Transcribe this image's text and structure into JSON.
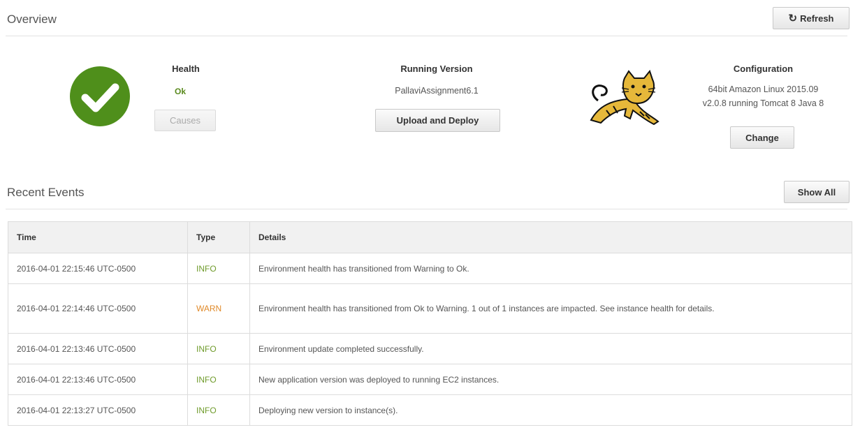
{
  "overview": {
    "title": "Overview",
    "refresh_label": "Refresh"
  },
  "health": {
    "title": "Health",
    "status": "Ok",
    "causes_label": "Causes",
    "icon": "green-check-circle-icon"
  },
  "running_version": {
    "title": "Running Version",
    "version": "PallaviAssignment6.1",
    "upload_label": "Upload and Deploy"
  },
  "configuration": {
    "title": "Configuration",
    "line1": "64bit Amazon Linux 2015.09",
    "line2": "v2.0.8 running Tomcat 8 Java 8",
    "change_label": "Change",
    "icon": "tomcat-logo-icon"
  },
  "recent_events": {
    "title": "Recent Events",
    "show_all_label": "Show All",
    "columns": [
      "Time",
      "Type",
      "Details"
    ],
    "rows": [
      {
        "time": "2016-04-01 22:15:46 UTC-0500",
        "type": "INFO",
        "details": "Environment health has transitioned from Warning to Ok."
      },
      {
        "time": "2016-04-01 22:14:46 UTC-0500",
        "type": "WARN",
        "details": "Environment health has transitioned from Ok to Warning. 1 out of 1 instances are impacted. See instance health for details."
      },
      {
        "time": "2016-04-01 22:13:46 UTC-0500",
        "type": "INFO",
        "details": "Environment update completed successfully."
      },
      {
        "time": "2016-04-01 22:13:46 UTC-0500",
        "type": "INFO",
        "details": "New application version was deployed to running EC2 instances."
      },
      {
        "time": "2016-04-01 22:13:27 UTC-0500",
        "type": "INFO",
        "details": "Deploying new version to instance(s)."
      }
    ]
  },
  "colors": {
    "ok_green": "#5a8a1e",
    "info_green": "#6f9b2b",
    "warn_orange": "#e08a2a",
    "check_green": "#4f8f1b"
  }
}
